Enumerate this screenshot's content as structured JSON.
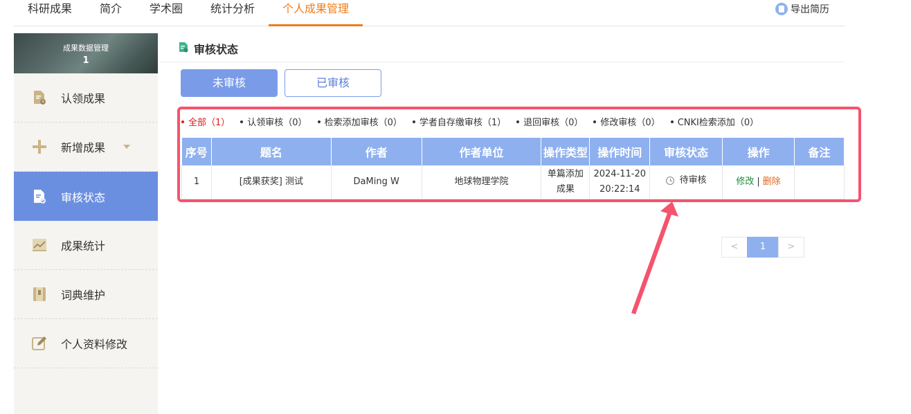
{
  "nav": {
    "tabs": [
      {
        "label": "科研成果"
      },
      {
        "label": "简介"
      },
      {
        "label": "学术圈"
      },
      {
        "label": "统计分析"
      },
      {
        "label": "个人成果管理",
        "active": true
      }
    ],
    "export_label": "导出简历"
  },
  "sidebar": {
    "header_title": "成果数据管理",
    "header_count": "1",
    "items": [
      {
        "label": "认领成果",
        "icon": "document-clock-icon"
      },
      {
        "label": "新增成果",
        "icon": "plus-icon",
        "has_dropdown": true
      },
      {
        "label": "审核状态",
        "icon": "document-check-icon",
        "active": true
      },
      {
        "label": "成果统计",
        "icon": "chart-icon"
      },
      {
        "label": "词典维护",
        "icon": "book-icon"
      },
      {
        "label": "个人资料修改",
        "icon": "edit-icon"
      }
    ]
  },
  "main": {
    "title": "审核状态",
    "buttons": {
      "pending": "未审核",
      "reviewed": "已审核"
    },
    "filters": [
      {
        "label": "全部（1）",
        "active": true
      },
      {
        "label": "认领审核（0）"
      },
      {
        "label": "检索添加审核（0）"
      },
      {
        "label": "学者自存缴审核（1）"
      },
      {
        "label": "退回审核（0）"
      },
      {
        "label": "修改审核（0）"
      },
      {
        "label": "CNKI检索添加（0）"
      }
    ],
    "table": {
      "headers": [
        "序号",
        "题名",
        "作者",
        "作者单位",
        "操作类型",
        "操作时间",
        "审核状态",
        "操作",
        "备注"
      ],
      "rows": [
        {
          "index": "1",
          "title": "[成果获奖] 测试",
          "author": "DaMing W",
          "affiliation": "地球物理学院",
          "op_type": "单篇添加成果",
          "op_time": "2024-11-20 20:22:14",
          "status": "待审核",
          "edit": "修改",
          "sep": "|",
          "delete": "删除",
          "note": ""
        }
      ]
    },
    "pagination": {
      "prev": "<",
      "current": "1",
      "next": ">"
    }
  },
  "colors": {
    "accent_orange": "#f07c1a",
    "primary_blue": "#7a9ce8",
    "highlight_red": "#f5536e"
  }
}
